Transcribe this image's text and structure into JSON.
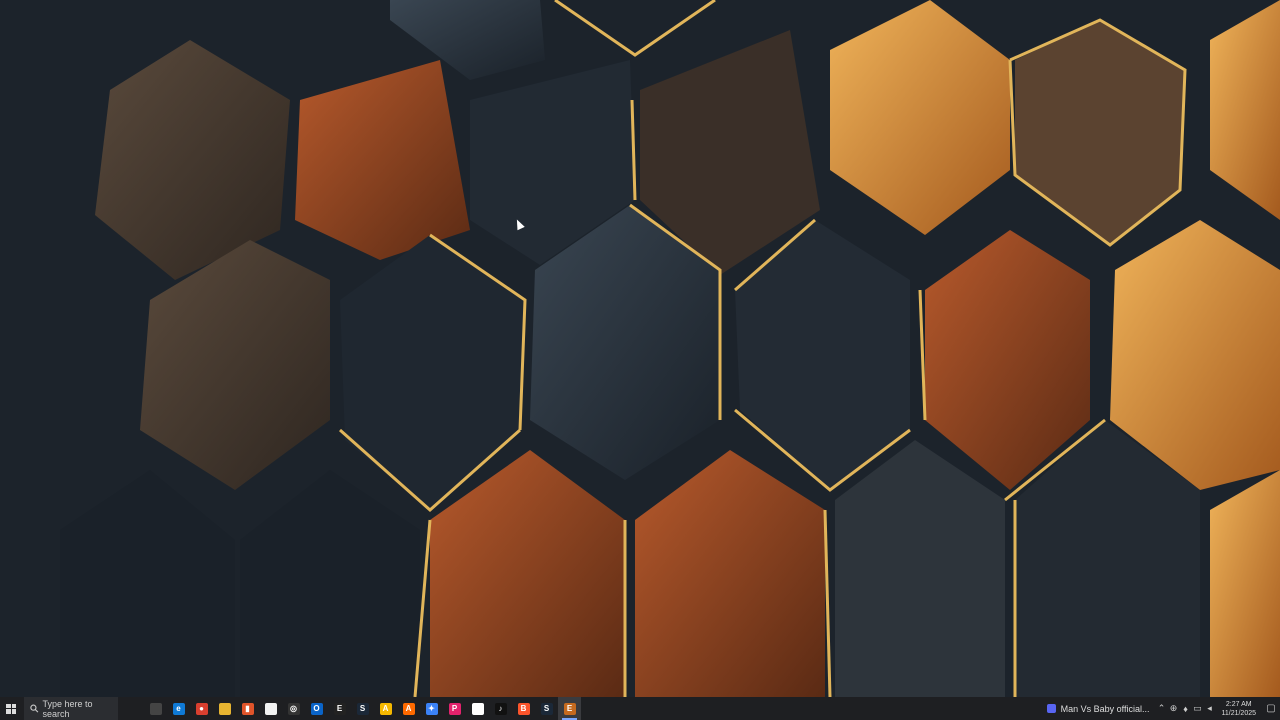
{
  "desktop": {
    "wallpaper": "hexagon-wood-wallpaper"
  },
  "taskbar": {
    "search_placeholder": "Type here to search",
    "pinned": [
      {
        "name": "task-view-icon",
        "label": "",
        "color": "#444"
      },
      {
        "name": "edge-icon",
        "label": "e",
        "color": "#0f7ad6"
      },
      {
        "name": "chrome-icon",
        "label": "●",
        "color": "#d93f2f"
      },
      {
        "name": "file-explorer-icon",
        "label": "",
        "color": "#e7b431"
      },
      {
        "name": "app-red-icon",
        "label": "▮",
        "color": "#e0542a"
      },
      {
        "name": "notepad-icon",
        "label": "",
        "color": "#f2f2f2"
      },
      {
        "name": "github-icon",
        "label": "◎",
        "color": "#333"
      },
      {
        "name": "outlook-icon",
        "label": "O",
        "color": "#0a64c8"
      },
      {
        "name": "epic-games-icon",
        "label": "E",
        "color": "#222"
      },
      {
        "name": "steam-icon",
        "label": "S",
        "color": "#1b2838"
      },
      {
        "name": "app-yellow-icon",
        "label": "A",
        "color": "#f5b800"
      },
      {
        "name": "app-orange-icon",
        "label": "A",
        "color": "#ff6a00"
      },
      {
        "name": "app-blue-icon",
        "label": "✦",
        "color": "#3b82f6"
      },
      {
        "name": "app-pink-icon",
        "label": "P",
        "color": "#e3226d"
      },
      {
        "name": "file-icon",
        "label": "",
        "color": "#ffffff"
      },
      {
        "name": "tiktok-icon",
        "label": "♪",
        "color": "#111"
      },
      {
        "name": "brave-icon",
        "label": "B",
        "color": "#fb542b"
      },
      {
        "name": "steam2-icon",
        "label": "S",
        "color": "#1b2838"
      },
      {
        "name": "epic2-icon",
        "label": "E",
        "color": "#c56a1f"
      }
    ],
    "active_app": "Man Vs Baby official...",
    "time": "2:27 AM",
    "date": "11/21/2025"
  }
}
